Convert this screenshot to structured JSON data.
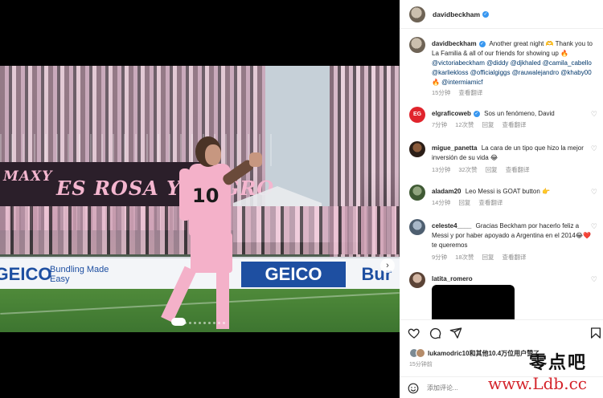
{
  "post": {
    "username": "davidbeckham",
    "caption_text": "Another great night 🫶 Thank you to La Familia & all of our friends for showing up 🔥",
    "caption_tags": "@victoriabeckham @diddy @djkhaled @camila_cabello @karliekloss @officialgiggs @rauwalejandro @khaby00 🔥 @intermiamicf",
    "caption_time": "15分钟",
    "caption_translate": "查看翻译"
  },
  "photo": {
    "banner_1": "MAXY",
    "banner_2": "ES ROSA Y NEGRO",
    "jersey_number": "10",
    "ads": [
      "GEICO",
      "Bundling Made Easy",
      "GEICO",
      "Bur"
    ],
    "next_label": "›"
  },
  "comments": [
    {
      "username": "elgraficoweb",
      "text": "Sos un fenómeno, David",
      "time": "7分钟",
      "likes": "12次赞",
      "reply": "回复",
      "translate": "查看翻译",
      "avatar_label": "EG"
    },
    {
      "username": "migue_panetta",
      "text": "La cara de un tipo que hizo la mejor inversión de su vida 😂",
      "time": "13分钟",
      "likes": "32次赞",
      "reply": "回复",
      "translate": "查看翻译"
    },
    {
      "username": "aladam20",
      "text": "Leo Messi is GOAT button 👉",
      "time": "14分钟",
      "likes": "",
      "reply": "回复",
      "translate": "查看翻译"
    },
    {
      "username": "celeste4____",
      "text": "Gracias Beckham por hacerlo feliz a Messi y por haber apoyado a Argentina en el 2014😂❤️ te queremos",
      "time": "9分钟",
      "likes": "18次赞",
      "reply": "回复",
      "translate": "查看翻译"
    },
    {
      "username": "latita_romero",
      "text": "",
      "time": "",
      "likes": "",
      "reply": "",
      "translate": ""
    }
  ],
  "footer": {
    "likes_user": "lukamodric10",
    "likes_rest": "和其他10.4万位用户赞了",
    "time": "15分钟前",
    "composer_placeholder": "添加评论..."
  },
  "watermark": {
    "cn": "零点吧",
    "url": "www.Ldb.cc"
  },
  "colors": {
    "verified": "#3897f0",
    "link": "#00376b",
    "muted": "#8e8e8e",
    "jersey_pink": "#f4b1c9"
  }
}
